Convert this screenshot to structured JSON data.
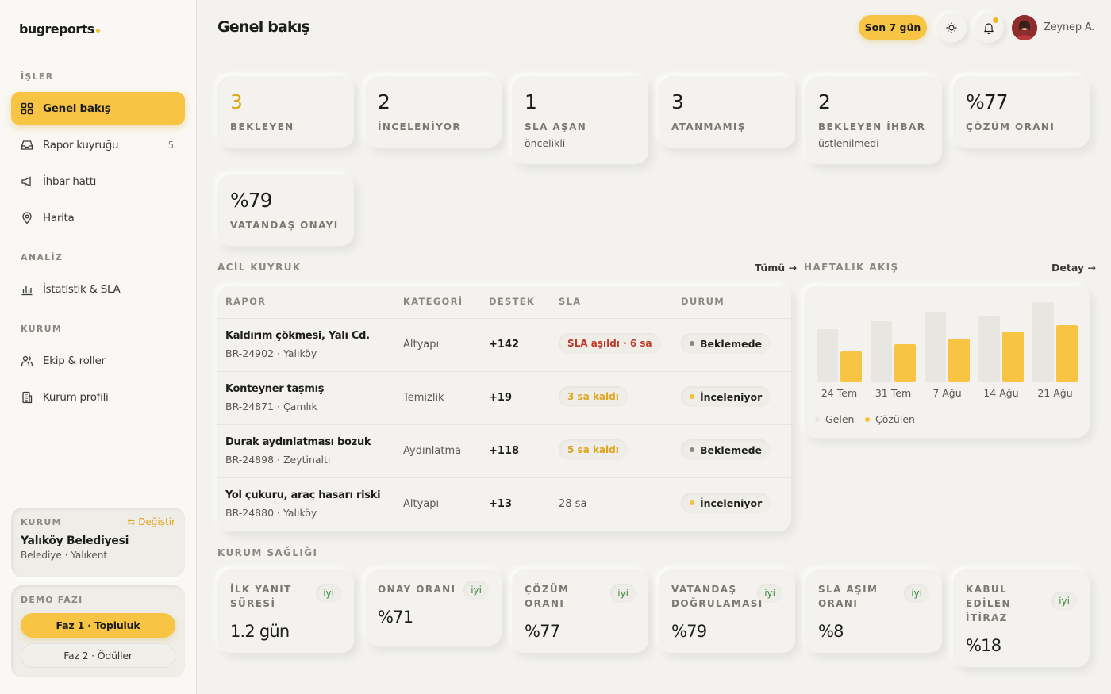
{
  "app": {
    "name": "bugreports"
  },
  "sidebar": {
    "sections": [
      {
        "label": "İŞLER"
      },
      {
        "label": "ANALİZ"
      },
      {
        "label": "KURUM"
      }
    ],
    "items": [
      {
        "label": "Genel bakış",
        "icon": "grid-icon",
        "active": true
      },
      {
        "label": "Rapor kuyruğu",
        "icon": "inbox-icon",
        "count": "5"
      },
      {
        "label": "İhbar hattı",
        "icon": "megaphone-icon"
      },
      {
        "label": "Harita",
        "icon": "map-pin-icon"
      },
      {
        "label": "İstatistik & SLA",
        "icon": "bar-chart-icon"
      },
      {
        "label": "Ekip & roller",
        "icon": "users-icon"
      },
      {
        "label": "Kurum profili",
        "icon": "building-icon"
      }
    ],
    "org": {
      "label": "KURUM",
      "change": "Değiştir",
      "name": "Yalıköy Belediyesi",
      "sub": "Belediye · Yalıkent"
    },
    "demo": {
      "label": "DEMO FAZI",
      "phase1": "Faz 1 · Topluluk",
      "phase2": "Faz 2 · Ödüller"
    }
  },
  "header": {
    "title": "Genel bakış",
    "range": "Son 7 gün",
    "user": "Zeynep A."
  },
  "kpis": [
    {
      "value": "3",
      "label": "BEKLEYEN",
      "sub": ""
    },
    {
      "value": "2",
      "label": "İNCELENİYOR",
      "sub": ""
    },
    {
      "value": "1",
      "label": "SLA AŞAN",
      "sub": "öncelikli"
    },
    {
      "value": "3",
      "label": "ATANMAMIŞ",
      "sub": ""
    },
    {
      "value": "2",
      "label": "BEKLEYEN İHBAR",
      "sub": "üstlenilmedi"
    },
    {
      "value": "%77",
      "label": "ÇÖZÜM ORANI",
      "sub": ""
    },
    {
      "value": "%79",
      "label": "VATANDAŞ ONAYI",
      "sub": ""
    }
  ],
  "queue": {
    "title": "ACİL KUYRUK",
    "link": "Tümü →",
    "headers": [
      "RAPOR",
      "KATEGORİ",
      "DESTEK",
      "SLA",
      "DURUM"
    ],
    "rows": [
      {
        "title": "Kaldırım çökmesi, Yalı Cd.",
        "sub": "BR-24902 · Yalıköy",
        "category": "Altyapı",
        "support": "+142",
        "sla": "SLA aşıldı · 6 sa",
        "sla_kind": "red",
        "status": "Beklemede",
        "status_color": "#8a8880"
      },
      {
        "title": "Konteyner taşmış",
        "sub": "BR-24871 · Çamlık",
        "category": "Temizlik",
        "support": "+19",
        "sla": "3 sa kaldı",
        "sla_kind": "yellow",
        "status": "İnceleniyor",
        "status_color": "#f5c034"
      },
      {
        "title": "Durak aydınlatması bozuk",
        "sub": "BR-24898 · Zeytinaltı",
        "category": "Aydınlatma",
        "support": "+118",
        "sla": "5 sa kaldı",
        "sla_kind": "yellow",
        "status": "Beklemede",
        "status_color": "#8a8880"
      },
      {
        "title": "Yol çukuru, araç hasarı riski",
        "sub": "BR-24880 · Yalıköy",
        "category": "Altyapı",
        "support": "+13",
        "sla": "28 sa",
        "sla_kind": "plain",
        "status": "İnceleniyor",
        "status_color": "#f5c034"
      }
    ]
  },
  "weekly": {
    "title": "HAFTALIK AKIŞ",
    "link": "Detay →",
    "legend": [
      "Gelen",
      "Çözülen"
    ],
    "colors": {
      "incoming": "#e8e6e1",
      "resolved": "#f7c443"
    }
  },
  "chart_data": {
    "type": "bar",
    "categories": [
      "24 Tem",
      "31 Tem",
      "7 Ağu",
      "14 Ağu",
      "21 Ağu"
    ],
    "series": [
      {
        "name": "Gelen",
        "values": [
          66,
          76,
          88,
          82,
          100
        ]
      },
      {
        "name": "Çözülen",
        "values": [
          38,
          47,
          54,
          63,
          71
        ]
      }
    ],
    "ylim": [
      0,
      100
    ]
  },
  "health": {
    "title": "KURUM SAĞLIĞI",
    "cards": [
      {
        "label": "İLK YANIT SÜRESİ",
        "badge": "iyi",
        "value": "1.2 gün"
      },
      {
        "label": "ONAY ORANI",
        "badge": "iyi",
        "value": "%71"
      },
      {
        "label": "ÇÖZÜM ORANI",
        "badge": "iyi",
        "value": "%77"
      },
      {
        "label": "VATANDAŞ DOĞRULAMASI",
        "badge": "iyi",
        "value": "%79"
      },
      {
        "label": "SLA AŞIM ORANI",
        "badge": "iyi",
        "value": "%8"
      },
      {
        "label": "KABUL EDİLEN İTİRAZ",
        "badge": "iyi",
        "value": "%18"
      }
    ]
  }
}
